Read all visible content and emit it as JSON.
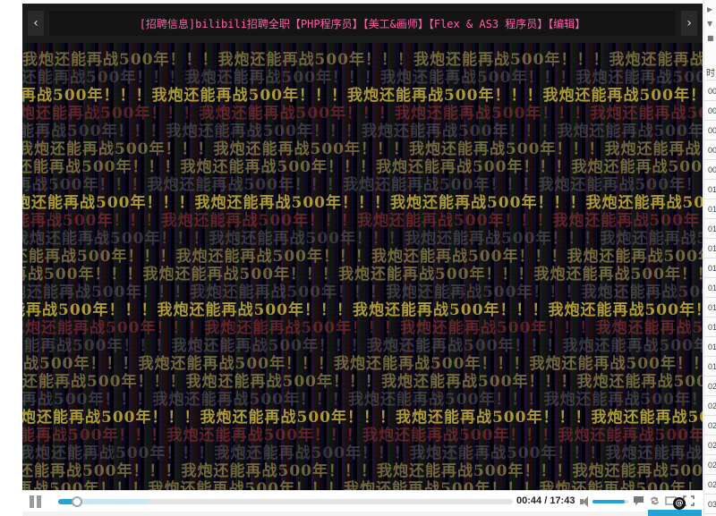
{
  "topbar": {
    "prev_label": "‹",
    "next_label": "›",
    "notice_text": "[招聘信息]bilibili招聘全职【PHP程序员】【美工&画师】【Flex & AS3 程序员】【编辑】"
  },
  "video": {
    "danmaku_text": "我炮还能再战500年！！！"
  },
  "controls": {
    "current_time": "00:44",
    "time_separator": " / ",
    "duration": "17:43",
    "progress_fraction": 0.042,
    "buffered_fraction": 0.2,
    "volume_fraction": 0.9
  },
  "side_panel": {
    "header": "时",
    "rows": [
      "00",
      "00",
      "00",
      "00",
      "00",
      "01",
      "01",
      "01",
      "01",
      "01",
      "01",
      "01",
      "01",
      "01",
      "01",
      "02",
      "02",
      "02",
      "02",
      "02",
      "02",
      "03"
    ]
  },
  "icons": {
    "prev": "chevron-left-icon",
    "next": "chevron-right-icon",
    "play_pause": "pause-icon",
    "volume": "volume-icon",
    "danmaku_toggle": "comment-bubble-icon",
    "loop": "loop-icon",
    "widescreen": "widescreen-icon",
    "fullscreen": "fullscreen-icon"
  },
  "colors": {
    "accent": "#23a3d4",
    "notice_text": "#ff5fa8",
    "danmaku": "#c8b45a"
  }
}
